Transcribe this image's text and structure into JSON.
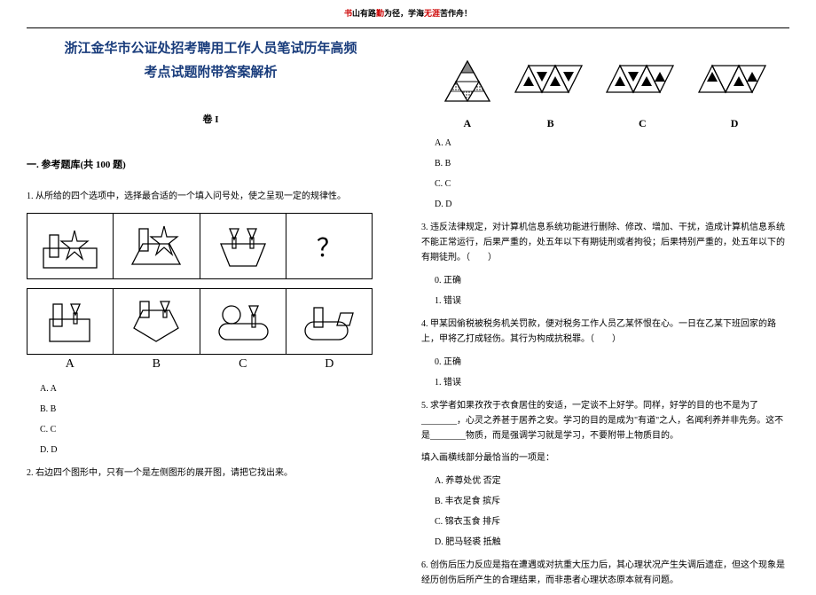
{
  "header": {
    "part1_red": "书",
    "part1": "山有路",
    "part2_red": "勤",
    "part2": "为径，学海",
    "part3_red": "无涯",
    "part3": "苦作舟！"
  },
  "title_line1": "浙江金华市公证处招考聘用工作人员笔试历年高频",
  "title_line2": "考点试题附带答案解析",
  "volume": "卷 I",
  "section": "一. 参考题库(共 100 题)",
  "q1": {
    "text": "1. 从所给的四个选项中，选择最合适的一个填入问号处，使之呈现一定的规律性。",
    "labels": [
      "A",
      "B",
      "C",
      "D"
    ],
    "qmark": "？",
    "options": {
      "a": "A. A",
      "b": "B. B",
      "c": "C. C",
      "d": "D. D"
    }
  },
  "q2": {
    "text": "2. 右边四个图形中，只有一个是左侧图形的展开图，请把它找出来。",
    "labels": [
      "A",
      "B",
      "C",
      "D"
    ],
    "options": {
      "a": "A. A",
      "b": "B. B",
      "c": "C. C",
      "d": "D. D"
    }
  },
  "q3": {
    "text": "3. 违反法律规定，对计算机信息系统功能进行删除、修改、增加、干扰，造成计算机信息系统不能正常运行，后果严重的，处五年以下有期徒刑或者拘役；后果特别严重的，处五年以下的有期徒刑。（　　）",
    "opt0": "0. 正确",
    "opt1": "1. 错误"
  },
  "q4": {
    "text": "4. 甲某因偷税被税务机关罚款，便对税务工作人员乙某怀恨在心。一日在乙某下班回家的路上，甲将乙打成轻伤。其行为构成抗税罪。（　　）",
    "opt0": "0. 正确",
    "opt1": "1. 错误"
  },
  "q5": {
    "text": "5. 求学者如果孜孜于衣食居住的安适，一定谈不上好学。同样，好学的目的也不是为了________，心灵之养甚于居养之安。学习的目的是成为\"有道\"之人，名闻利养并非先务。这不是________物质，而是强调学习就是学习，不要附带上物质目的。",
    "prompt": "填入画横线部分最恰当的一项是：",
    "optA": "A. 养尊处优  否定",
    "optB": "B. 丰衣足食  摈斥",
    "optC": "C. 锦衣玉食  排斥",
    "optD": "D. 肥马轻裘  抵触"
  },
  "q6": {
    "text": "6. 创伤后压力反应是指在遭遇或对抗重大压力后，其心理状况产生失调后遗症，但这个现象是经历创伤后所产生的合理结果，而非患者心理状态原本就有问题。"
  }
}
